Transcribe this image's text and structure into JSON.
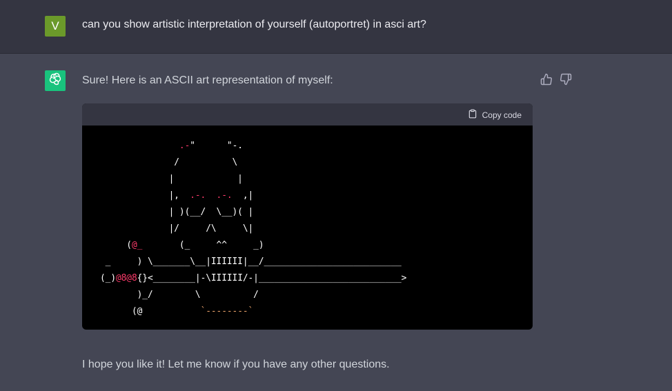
{
  "colors": {
    "user_avatar_bg": "#6b9a2a",
    "bot_avatar_bg": "#19c37d",
    "user_row_bg": "#343541",
    "assistant_row_bg": "#444654",
    "code_bg": "#000000",
    "accent_red": "#ff3b6b",
    "accent_orange": "#e9a26a"
  },
  "user": {
    "avatar_letter": "V",
    "message": "can you show artistic interpretation of yourself (autoportret) in asci art?"
  },
  "assistant": {
    "avatar_icon": "openai-logo-icon",
    "intro": "Sure! Here is an ASCII art representation of myself:",
    "outro": "I hope you like it! Let me know if you have any other questions.",
    "feedback": {
      "like_icon": "thumbs-up-icon",
      "dislike_icon": "thumbs-down-icon"
    }
  },
  "code": {
    "copy_label": "Copy code",
    "copy_icon": "clipboard-icon",
    "lines": [
      [
        [
          "               ",
          ""
        ],
        [
          ".-",
          "r"
        ],
        [
          "\"",
          ""
        ],
        [
          "      ",
          ""
        ],
        [
          "\"",
          ""
        ],
        [
          "-.",
          ""
        ]
      ],
      [
        [
          "              /          \\",
          ""
        ]
      ],
      [
        [
          "             |            |",
          ""
        ]
      ],
      [
        [
          "             |,  ",
          ""
        ],
        [
          ".-.",
          "r"
        ],
        [
          "  ",
          ""
        ],
        [
          ".-.",
          "r"
        ],
        [
          "  ,|",
          ""
        ]
      ],
      [
        [
          "             | )(__/  \\__)( |",
          ""
        ]
      ],
      [
        [
          "             |/     /\\     \\|",
          ""
        ]
      ],
      [
        [
          "     (",
          ""
        ],
        [
          "@_",
          "r"
        ],
        [
          "       (_     ^^     _)",
          ""
        ]
      ],
      [
        [
          " _     ) \\_______\\__|IIIIII|__/__________________________",
          ""
        ]
      ],
      [
        [
          "(_)",
          ""
        ],
        [
          "@8@8",
          "r"
        ],
        [
          "{}<________|-\\IIIIII/-|___________________________>",
          ""
        ]
      ],
      [
        [
          "       )_/        \\          /",
          ""
        ]
      ],
      [
        [
          "      (@           ",
          ""
        ],
        [
          "`--------`",
          "o"
        ]
      ]
    ]
  }
}
